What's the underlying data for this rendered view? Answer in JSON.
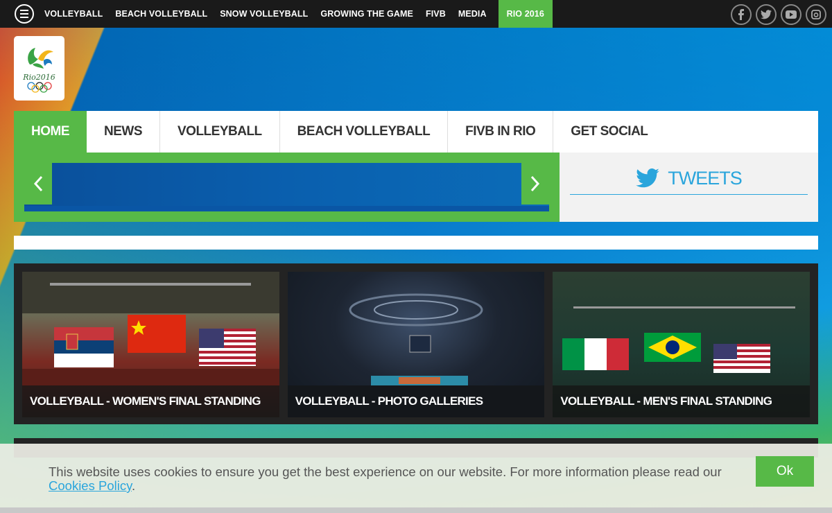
{
  "topbar": {
    "items": [
      "VOLLEYBALL",
      "BEACH VOLLEYBALL",
      "SNOW VOLLEYBALL",
      "GROWING THE GAME",
      "FIVB",
      "MEDIA",
      "RIO 2016"
    ],
    "active": "RIO 2016",
    "social": [
      "facebook-icon",
      "twitter-icon",
      "youtube-icon",
      "instagram-icon"
    ]
  },
  "logo": {
    "text": "Rio2016"
  },
  "mainnav": {
    "items": [
      "HOME",
      "NEWS",
      "VOLLEYBALL",
      "BEACH VOLLEYBALL",
      "FIVB IN RIO",
      "GET SOCIAL"
    ]
  },
  "tweets": {
    "label": "TWEETS"
  },
  "cards": [
    {
      "caption": "VOLLEYBALL - WOMEN'S FINAL STANDING"
    },
    {
      "caption": "VOLLEYBALL - PHOTO GALLERIES"
    },
    {
      "caption": "VOLLEYBALL - MEN'S FINAL STANDING"
    }
  ],
  "cookie": {
    "text": "This website uses cookies to ensure you get the best experience on our website. For more information please read our ",
    "link": "Cookies Policy",
    "suffix": ".",
    "ok": "Ok"
  },
  "colors": {
    "accent": "#57b947",
    "twitter": "#2aa5dc",
    "dark": "#1a1a1a"
  }
}
